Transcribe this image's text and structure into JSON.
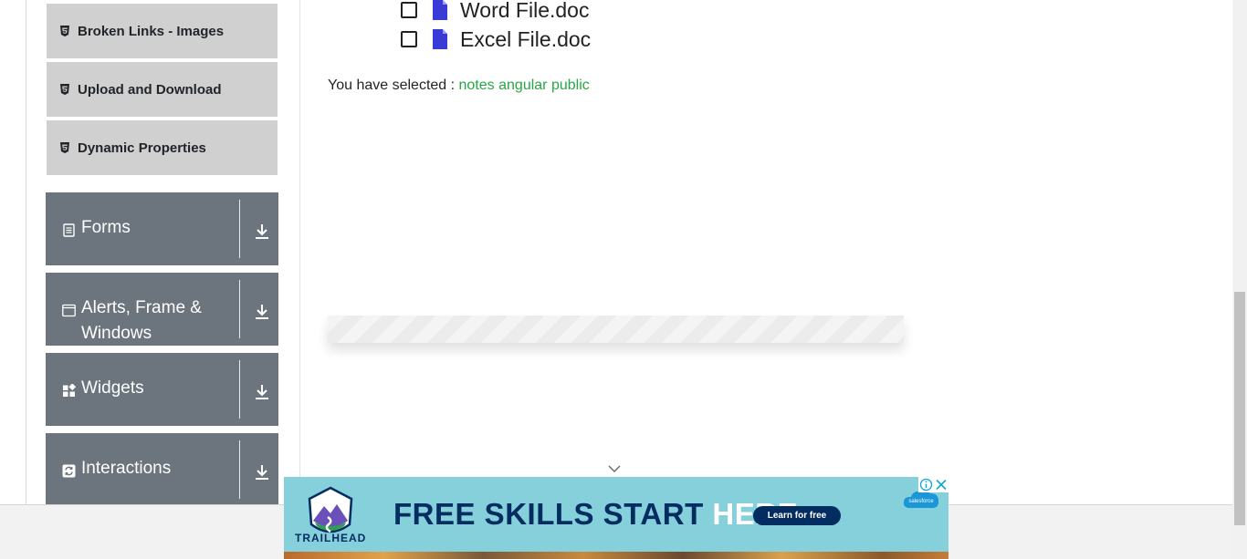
{
  "sidebar": {
    "sub_items": [
      {
        "label": "Broken Links - Images",
        "icon": "html5-icon"
      },
      {
        "label": "Upload and Download",
        "icon": "html5-icon"
      },
      {
        "label": "Dynamic Properties",
        "icon": "html5-icon"
      }
    ],
    "groups": [
      {
        "label": "Forms",
        "icon": "form-icon"
      },
      {
        "label": "Alerts, Frame & Windows",
        "icon": "window-icon"
      },
      {
        "label": "Widgets",
        "icon": "widgets-icon"
      },
      {
        "label": "Interactions",
        "icon": "interactions-icon"
      }
    ]
  },
  "main": {
    "files": [
      {
        "name": "Word File.doc",
        "checked": false
      },
      {
        "name": "Excel File.doc",
        "checked": false
      }
    ],
    "selected_prefix": "You have selected :",
    "selected_value": "notes angular public"
  },
  "ad": {
    "brand": "TRAILHEAD",
    "headline_part1": "FREE SKILLS START",
    "headline_part2": "HERE.",
    "cta": "Learn for free",
    "partner": "salesforce"
  },
  "colors": {
    "accent_green": "#28a745",
    "sidebar_group_bg": "#6c757d",
    "sidebar_item_bg": "#d0d0d0",
    "file_icon": "#3a3ad6",
    "ad_bg": "#86d0db",
    "ad_navy": "#032d60"
  }
}
